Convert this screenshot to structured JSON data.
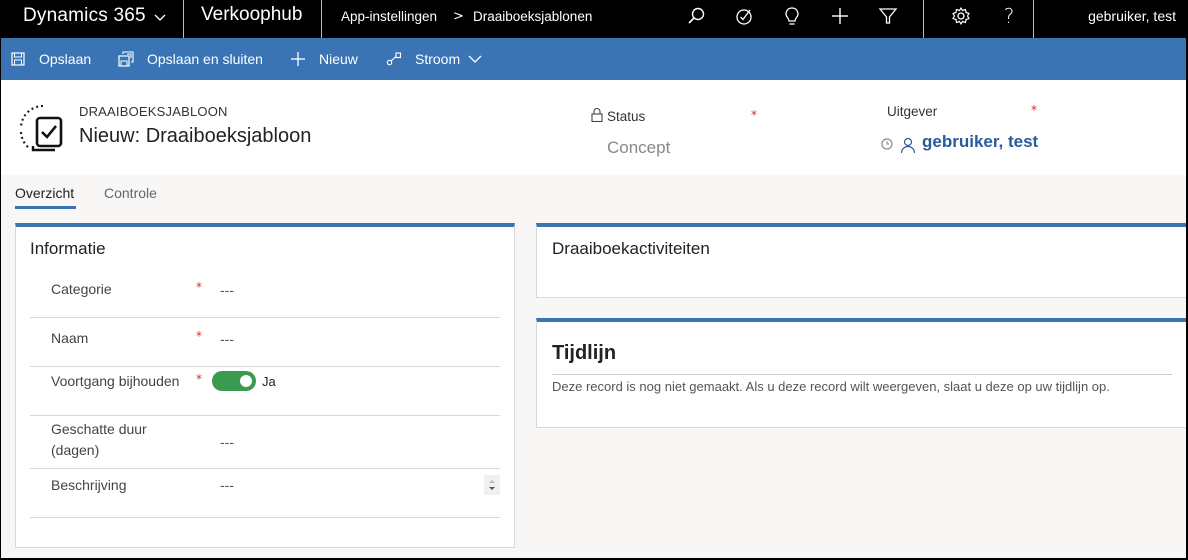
{
  "navbar": {
    "app_name": "Dynamics 365",
    "hub_name": "Verkoophub",
    "breadcrumb": [
      "App-instellingen",
      "Draaiboeksjablonen"
    ],
    "icons": [
      "search-icon",
      "assistant-icon",
      "lightbulb-icon",
      "plus-icon",
      "filter-icon",
      "gear-icon",
      "help-icon"
    ],
    "help_glyph": "?",
    "user": "gebruiker, test"
  },
  "commandbar": {
    "save": "Opslaan",
    "save_close": "Opslaan en sluiten",
    "new": "Nieuw",
    "flow": "Stroom"
  },
  "header": {
    "entity_type": "DRAAIBOEKSJABLOON",
    "title": "Nieuw: Draaiboeksjabloon",
    "status_label": "Status",
    "status_value": "Concept",
    "owner_label": "Uitgever",
    "owner_value": "gebruiker, test",
    "required_mark": "*"
  },
  "tabs": [
    {
      "label": "Overzicht",
      "active": true
    },
    {
      "label": "Controle",
      "active": false
    }
  ],
  "info_section": {
    "title": "Informatie",
    "fields": [
      {
        "label": "Categorie",
        "required": true,
        "value": "---"
      },
      {
        "label": "Naam",
        "required": true,
        "value": "---"
      },
      {
        "label": "Voortgang bijhouden",
        "required": true,
        "value": "Ja",
        "type": "toggle",
        "on": true
      },
      {
        "label": "Geschatte duur (dagen)",
        "label_line1": "Geschatte duur",
        "label_line2": "(dagen)",
        "required": false,
        "value": "---"
      },
      {
        "label": "Beschrijving",
        "required": false,
        "value": "---"
      }
    ]
  },
  "activities_section": {
    "title": "Draaiboekactiviteiten"
  },
  "timeline_section": {
    "title": "Tijdlijn",
    "message": "Deze record is nog niet gemaakt. Als u deze record wilt weergeven, slaat u deze op uw tijdlijn op."
  },
  "colors": {
    "accent": "#3a74b4",
    "toggle_on": "#3a9a50",
    "required": "#d42d2d",
    "owner_link": "#2c5a9a"
  }
}
